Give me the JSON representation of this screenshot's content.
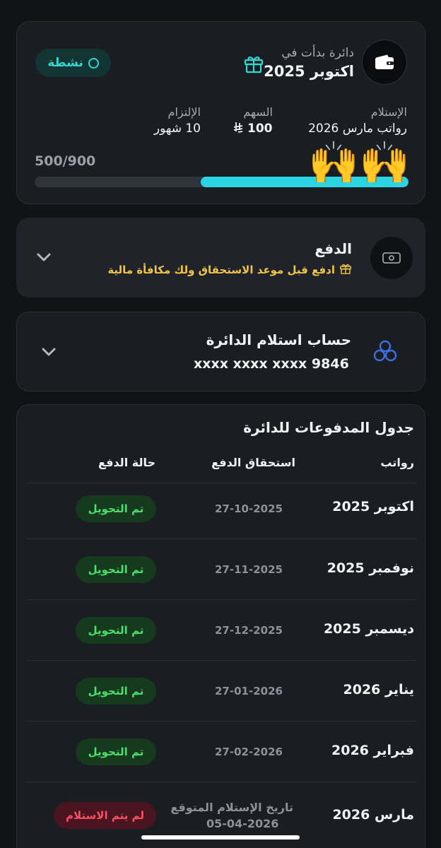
{
  "circle": {
    "started_label": "دائرة بدأت في",
    "start_month": "اكتوبر 2025",
    "status": "نشطة",
    "receipt_label": "الإستلام",
    "receipt_value": "رواتب مارس 2026",
    "share_label": "السهم",
    "share_value": "100",
    "currency_symbol": "⃁",
    "commitment_label": "الإلتزام",
    "commitment_value": "10 شهور",
    "progress_text": "500/900",
    "progress_fraction": 0.556,
    "emoji": "🙌🙌"
  },
  "payment": {
    "title": "الدفع",
    "subtitle": "ادفع قبل موعد الاستحقاق ولك مكافأة مالية"
  },
  "account": {
    "title": "حساب استلام الدائرة",
    "number": "xxxx xxxx xxxx 9846"
  },
  "schedule": {
    "title": "جدول المدفوعات للدائرة",
    "headers": {
      "salary": "رواتب",
      "due": "استحقاق الدفع",
      "status": "حالة الدفع"
    },
    "rows": [
      {
        "month": "اكتوبر 2025",
        "date": "27-10-2025",
        "status": "تم التحويل"
      },
      {
        "month": "نوفمبر 2025",
        "date": "27-11-2025",
        "status": "تم التحويل"
      },
      {
        "month": "ديسمبر 2025",
        "date": "27-12-2025",
        "status": "تم التحويل"
      },
      {
        "month": "يناير 2026",
        "date": "27-01-2026",
        "status": "تم التحويل"
      },
      {
        "month": "فبراير 2026",
        "date": "27-02-2026",
        "status": "تم التحويل"
      },
      {
        "month": "مارس 2026",
        "expected_label": "تاريخ الإستلام المتوقع",
        "date": "05-04-2026",
        "status": "لم يتم الاستلام"
      }
    ]
  },
  "colors": {
    "accent": "#2ad4e0",
    "success": "#4be06c",
    "error": "#ff4d63",
    "reward": "#f1c447"
  }
}
